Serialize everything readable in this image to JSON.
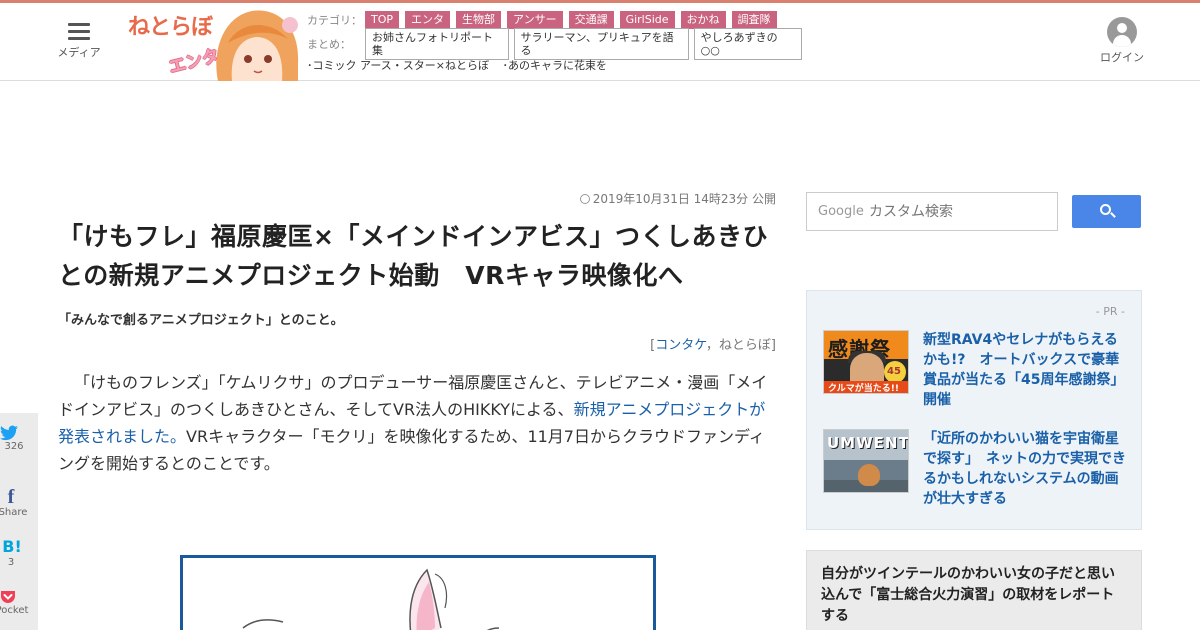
{
  "header": {
    "menu_label": "メディア",
    "logo": {
      "line1": "ねとらぼ",
      "line2": "エンタ"
    },
    "category_label": "カテゴリ：",
    "categories": [
      "TOP",
      "エンタ",
      "生物部",
      "アンサー",
      "交通課",
      "GirlSide",
      "おかね",
      "調査隊"
    ],
    "matome_label": "まとめ：",
    "matome": [
      "お姉さんフォトリポート集",
      "サラリーマン、プリキュアを語る",
      "やしろあずきの○○"
    ],
    "sublinks": [
      "･コミック アース・スター×ねとらぼ",
      "･あのキャラに花束を"
    ],
    "login_label": "ログイン"
  },
  "article": {
    "date": "2019年10月31日 14時23分 公開",
    "title": "「けもフレ」福原慶匡×「メインドインアビス」つくしあきひとの新規アニメプロジェクト始動　VRキャラ映像化へ",
    "lead": "「みんなで創るアニメプロジェクト」とのこと。",
    "credit_open": "[",
    "credit_author": "コンタケ",
    "credit_sep": "，",
    "credit_site": "ねとらぼ",
    "credit_close": "]",
    "body_part1": "「けものフレンズ」「ケムリクサ」のプロデューサー福原慶匡さんと、テレビアニメ・漫画「メイドインアビス」のつくしあきひとさん、そしてVR法人のHIKKYによる、",
    "body_link": "新規アニメプロジェクトが発表されました。",
    "body_part2": "VRキャラクター「モクリ」を映像化するため、11月7日からクラウドファンディングを開始するとのことです。"
  },
  "share": {
    "twitter_count": "326",
    "facebook_label": "Share",
    "hatena_count": "3",
    "pocket_label": "Pocket"
  },
  "search": {
    "google_label": "Google",
    "placeholder": "カスタム検索"
  },
  "sidebar": {
    "pr_label": "- PR -",
    "pr_items": [
      {
        "title": "新型RAV4やセレナがもらえるかも!?　オートバックスで豪華賞品が当たる「45周年感謝祭」開催",
        "thumb_text": "感謝祭",
        "thumb_caption": "クルマが当たる!!",
        "thumb_badge": "45"
      },
      {
        "title": "「近所のかわいい猫を宇宙衛星で探す」　ネットの力で実現できるかもしれないシステムの動画が壮大すぎる",
        "thumb_text": "UMWENTO"
      }
    ],
    "card2_title": "自分がツインテールのかわいい女の子だと思い込んで「富士総合火力演習」の取材をレポートする"
  },
  "colors": {
    "accent_line": "#d9806f",
    "category_tag": "#c9637f",
    "link": "#1a60a8",
    "search_button": "#4a86e8",
    "figure_border": "#1a5a9c"
  }
}
